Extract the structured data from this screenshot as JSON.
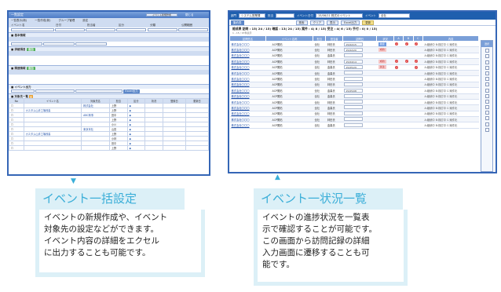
{
  "left_screen": {
    "title": "一覧設定",
    "toolbar_button": "イベント新規作成",
    "close_label": "閉じる",
    "top_tabs": [
      "一覧表示(新)",
      "一覧作成(新)",
      "グループ管理",
      "設定"
    ],
    "fields_row1": [
      "イベント名",
      "日付",
      "担当者",
      "区分",
      "分類",
      "公開範囲"
    ],
    "section1": "■ 基本情報",
    "section2": "■ 詳細項目",
    "section3": "■ 関連情報",
    "green_button": "追加",
    "export_section": "■ イベント出力",
    "export_button": "Excel出力",
    "list_section": "■ 対象先一覧",
    "list_headers": [
      "No",
      "イベント名",
      "対象先名",
      "担当",
      "区分",
      "状況",
      "登録日",
      "更新日"
    ],
    "list_rows": [
      {
        "event": "",
        "target": "株式会社",
        "owner": "上野"
      },
      {
        "event": "カスタム山手工場改善",
        "target": "",
        "owner": "上野"
      },
      {
        "event": "",
        "target": "ABC商事",
        "owner": "田中"
      },
      {
        "event": "",
        "target": "",
        "owner": "上野"
      },
      {
        "event": "",
        "target": "",
        "owner": "小川"
      },
      {
        "event": "",
        "target": "東京本社",
        "owner": "山田"
      },
      {
        "event": "カスタム山手工場改善",
        "target": "",
        "owner": "上野"
      },
      {
        "event": "",
        "target": "",
        "owner": "小林"
      },
      {
        "event": "",
        "target": "",
        "owner": "田中"
      },
      {
        "event": "",
        "target": "",
        "owner": "上野"
      }
    ]
  },
  "right_screen": {
    "dept_label": "部門",
    "dept_value": "システム営業課",
    "role_label": "担当",
    "event_date_label": "イベント日付",
    "event_date_value": "15/06/11 株式のイベント",
    "event_label": "イベント",
    "event_value": "全社",
    "tab": "集約表",
    "buttons": [
      "検索",
      "クリア",
      "表示",
      "Excel出力",
      "更新"
    ],
    "stats": "総成果 訪問 : 15( 24 / 15) 確認 : 13( 24 / 15) 案件 : 4( 8 / 15) 受注 : 4( 6 / 15) 手付 : 0( 0 / 15)",
    "pager": "1 - 15 / 15件表示",
    "headers": [
      "訪問先名",
      "イベント名称",
      "担当",
      "担当者",
      "訪問日",
      "状況",
      "A",
      "B",
      "C",
      "内容"
    ],
    "rows": [
      {
        "target": "株式会社〇〇〇",
        "event": "ACP開拓",
        "dept": "全社",
        "person": "林田氏",
        "date": "15/02/15",
        "status": "確認",
        "status_color": "blue",
        "a": true,
        "b": true,
        "c": true,
        "note": "A:継続中 B:検討中 C:案件化"
      },
      {
        "target": "株式会社〇〇〇",
        "event": "ACP開拓",
        "dept": "全社",
        "person": "林田氏",
        "date": "15/02/20",
        "status": "成約",
        "status_color": "pink",
        "a": false,
        "b": false,
        "c": false,
        "note": "A:継続中 B:検討中 C:案件化"
      },
      {
        "target": "株式会社〇〇〇",
        "event": "ACP開拓",
        "dept": "全社",
        "person": "金森氏",
        "date": "",
        "status": "",
        "status_color": "",
        "a": false,
        "b": false,
        "c": false,
        "note": "A:継続中 B:検討中 C:案件化"
      },
      {
        "target": "株式会社〇〇〇",
        "event": "ACP開拓",
        "dept": "全社",
        "person": "林田氏",
        "date": "15/04/14",
        "status": "成約",
        "status_color": "pink",
        "a": true,
        "b": true,
        "c": true,
        "note": "A:継続中 B:検討中 C:案件化"
      },
      {
        "target": "株式会社〇〇〇",
        "event": "ACP開拓",
        "dept": "全社",
        "person": "金森氏",
        "date": "15/05/29",
        "status": "失注",
        "status_color": "pink",
        "a": true,
        "b": false,
        "c": true,
        "note": "A:継続中 B:検討中 C:案件化"
      },
      {
        "target": "株式会社〇〇〇",
        "event": "ACP開拓",
        "dept": "全社",
        "person": "金森氏",
        "date": "",
        "status": "",
        "status_color": "",
        "a": false,
        "b": false,
        "c": false,
        "note": "A:継続中 B:検討中 C:案件化"
      },
      {
        "target": "株式会社〇〇〇",
        "event": "ACP開拓",
        "dept": "全社",
        "person": "林田氏",
        "date": "",
        "status": "",
        "status_color": "",
        "a": false,
        "b": false,
        "c": false,
        "note": "A:継続中 B:検討中 C:案件化"
      },
      {
        "target": "株式会社〇〇〇",
        "event": "ACP開拓",
        "dept": "全社",
        "person": "林田氏",
        "date": "",
        "status": "",
        "status_color": "",
        "a": false,
        "b": false,
        "c": false,
        "note": "A:継続中 B:検討中 C:案件化"
      },
      {
        "target": "株式会社〇〇〇",
        "event": "ACP開拓",
        "dept": "全社",
        "person": "金森氏",
        "date": "15/05/08",
        "status": "",
        "status_color": "",
        "a": false,
        "b": false,
        "c": false,
        "note": "A:継続中 B:検討中 C:案件化"
      },
      {
        "target": "株式会社〇〇〇",
        "event": "ACP開拓",
        "dept": "全社",
        "person": "金森氏",
        "date": "",
        "status": "",
        "status_color": "",
        "a": false,
        "b": false,
        "c": false,
        "note": "A:継続中 B:検討中 C:案件化"
      },
      {
        "target": "株式会社〇〇〇",
        "event": "ACP開拓",
        "dept": "全社",
        "person": "林田氏",
        "date": "",
        "status": "",
        "status_color": "",
        "a": false,
        "b": false,
        "c": false,
        "note": "A:継続中 B:検討中 C:案件化"
      },
      {
        "target": "株式会社〇〇〇",
        "event": "ACP開拓",
        "dept": "全社",
        "person": "金森氏",
        "date": "",
        "status": "",
        "status_color": "",
        "a": false,
        "b": false,
        "c": false,
        "note": "A:継続中 B:検討中 C:案件化"
      },
      {
        "target": "株式会社〇〇〇",
        "event": "ACP開拓",
        "dept": "全社",
        "person": "林田氏",
        "date": "",
        "status": "",
        "status_color": "",
        "a": false,
        "b": false,
        "c": false,
        "note": "A:継続中 B:検討中 C:案件化"
      },
      {
        "target": "株式会社〇〇〇",
        "event": "ACP開拓",
        "dept": "全社",
        "person": "林田氏",
        "date": "",
        "status": "",
        "status_color": "",
        "a": false,
        "b": false,
        "c": false,
        "note": "A:継続中 B:検討中 C:案件化"
      },
      {
        "target": "株式会社〇〇〇",
        "event": "ACP開拓",
        "dept": "全社",
        "person": "金森氏",
        "date": "",
        "status": "",
        "status_color": "",
        "a": false,
        "b": false,
        "c": false,
        "note": "A:継続中 B:検討中 C:案件化"
      }
    ],
    "side_header": "選択"
  },
  "callouts": {
    "left": {
      "title": "イベント一括設定",
      "lines": [
        "イベントの新規作成や、イベント",
        "対象先の設定などができます。",
        "イベント内容の詳細をエクセル",
        "に出力することも可能です。"
      ]
    },
    "right": {
      "title": "イベント一状況一覧",
      "lines": [
        "イベントの進捗状況を一覧表",
        "示で確認することが可能です。",
        "この画面から訪問記録の詳細",
        "入力画面に遷移することも可",
        "能です。"
      ]
    }
  },
  "colors": {
    "accent": "#3aaed8",
    "callout_bg": "#dcf0f7",
    "window_border": "#3566b6"
  }
}
